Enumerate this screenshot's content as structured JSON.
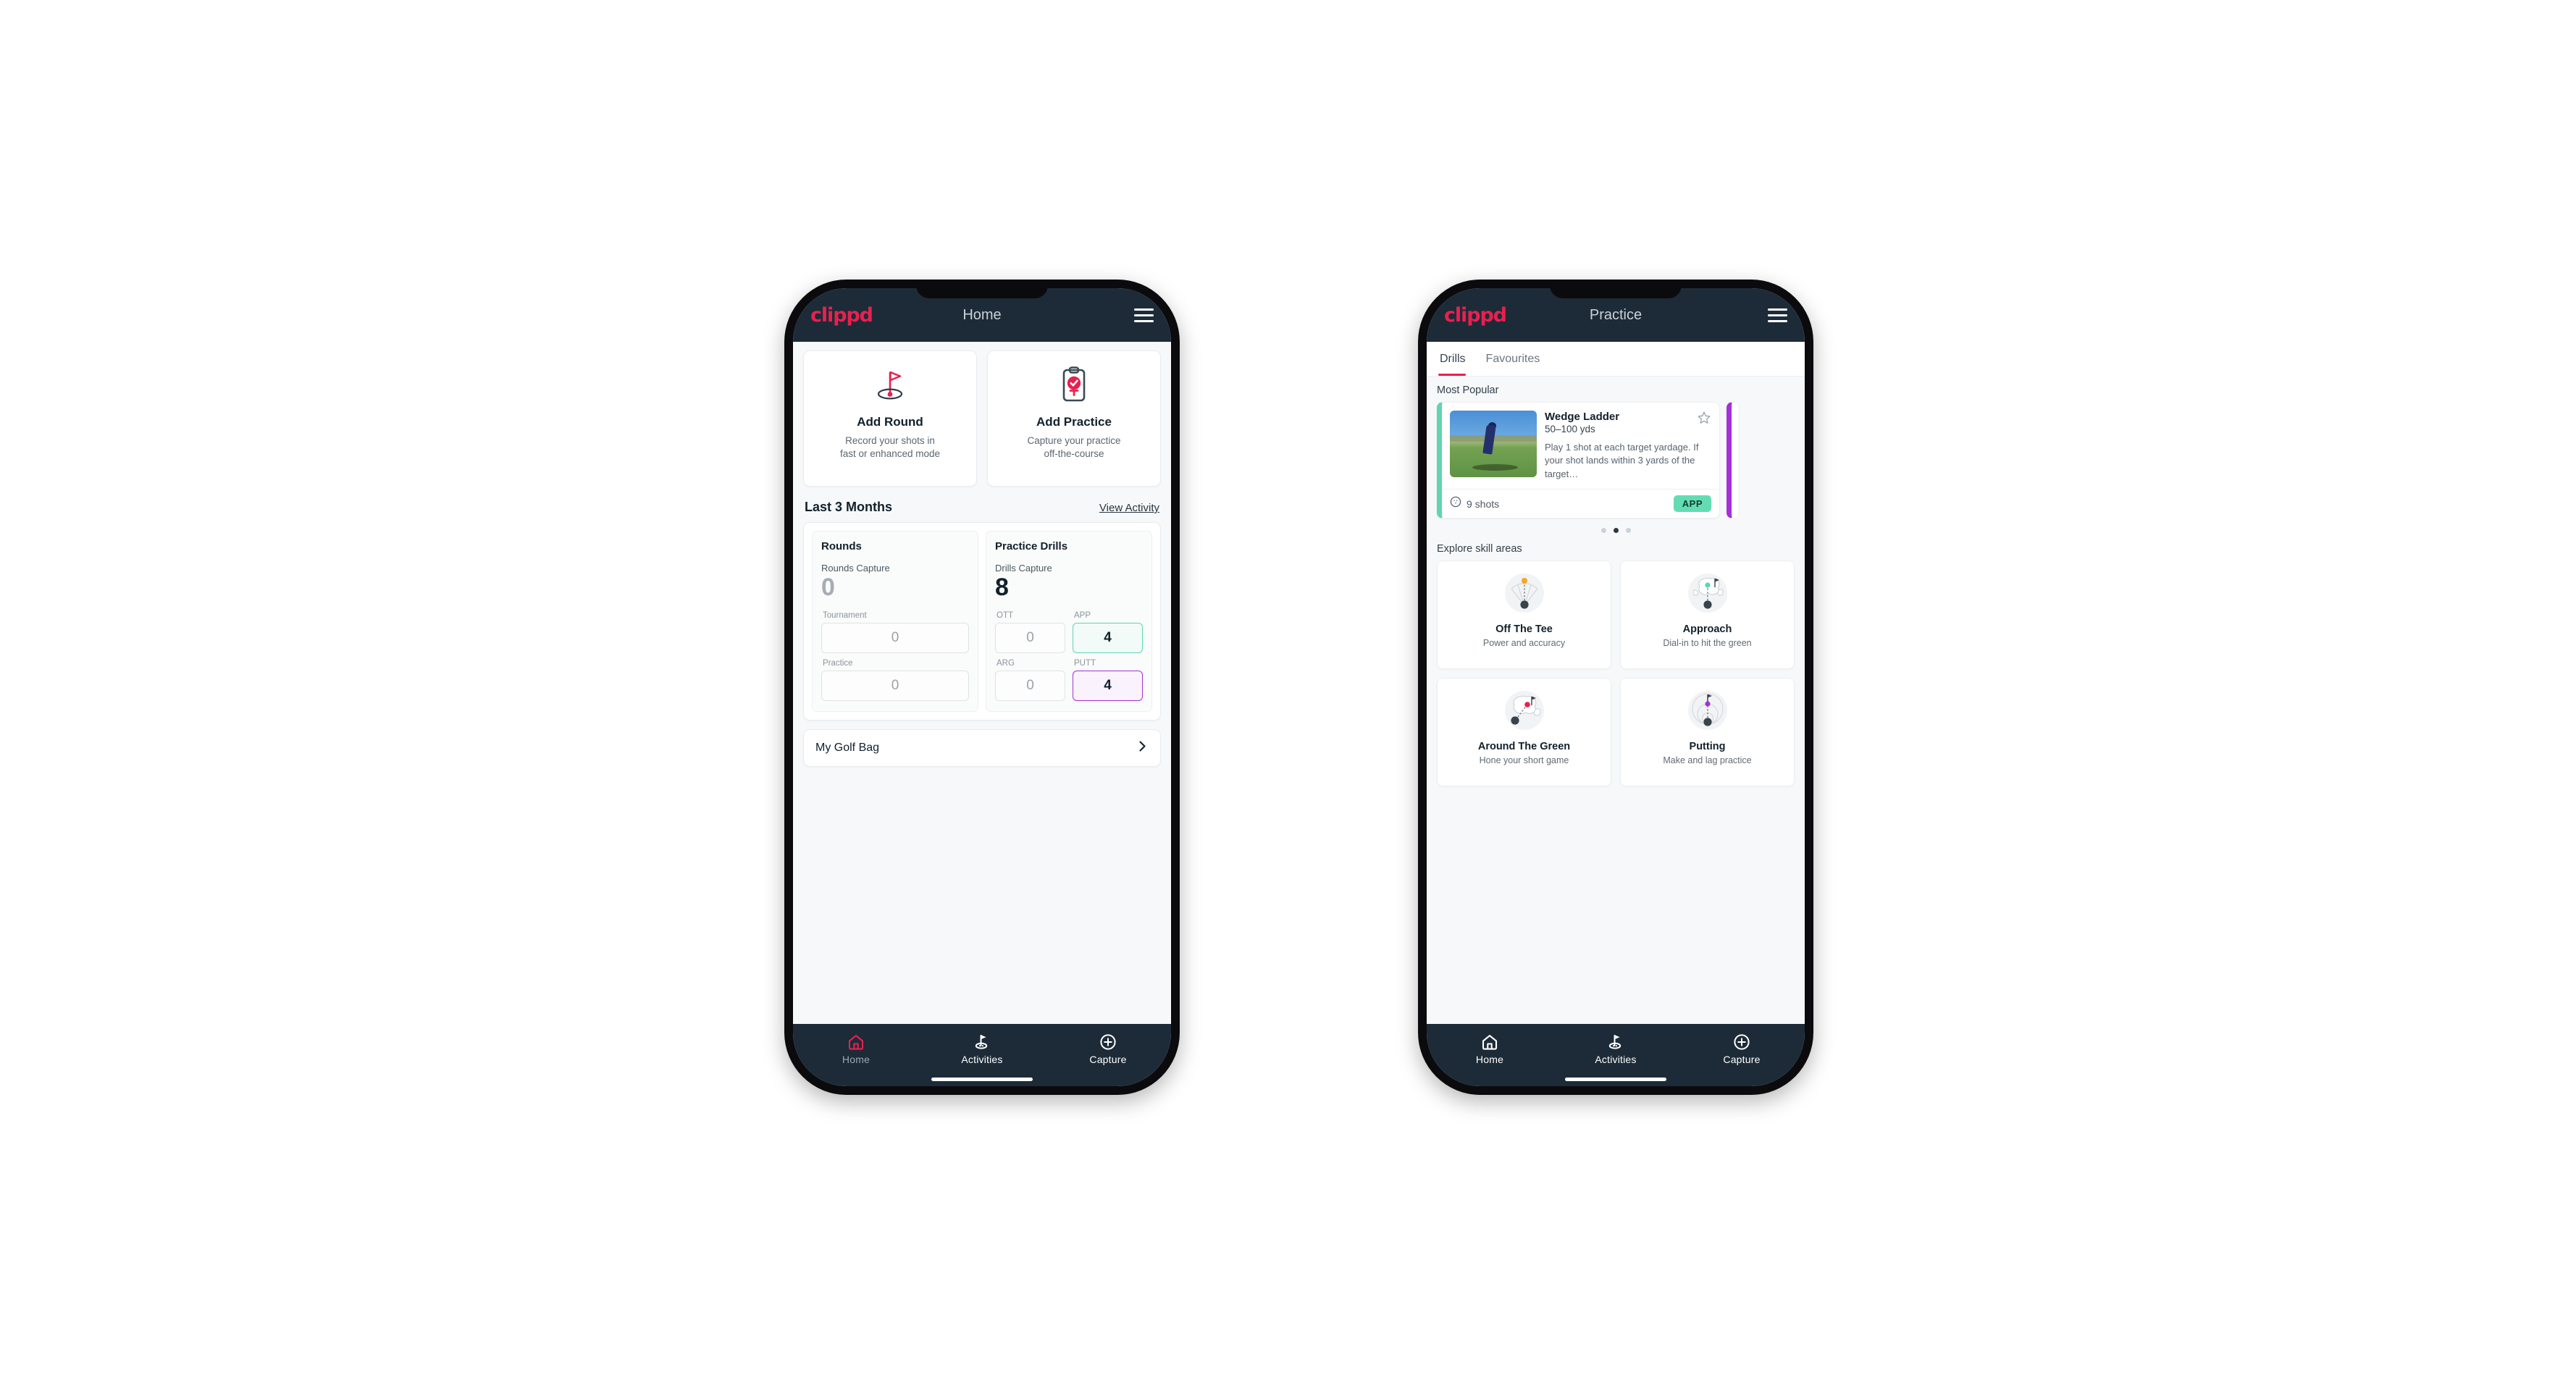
{
  "brand": {
    "name": "clippd",
    "accent": "#e8204e",
    "appbar_bg": "#1d2b38"
  },
  "phone_home": {
    "appbar": {
      "logo": "clippd",
      "title": "Home",
      "menu_icon": "hamburger-icon"
    },
    "actions": [
      {
        "icon": "golf-flag-hole-icon",
        "title": "Add Round",
        "subtitle_line1": "Record your shots in",
        "subtitle_line2": "fast or enhanced mode"
      },
      {
        "icon": "clipboard-check-tee-icon",
        "title": "Add Practice",
        "subtitle_line1": "Capture your practice",
        "subtitle_line2": "off-the-course"
      }
    ],
    "section": {
      "title": "Last 3 Months",
      "link": "View Activity"
    },
    "rounds": {
      "panel_title": "Rounds",
      "capture_label": "Rounds Capture",
      "capture_value": "0",
      "fields": [
        {
          "label": "Tournament",
          "value": "0",
          "state": "empty"
        },
        {
          "label": "Practice",
          "value": "0",
          "state": "empty"
        }
      ]
    },
    "drills": {
      "panel_title": "Practice Drills",
      "capture_label": "Drills Capture",
      "capture_value": "8",
      "fields": [
        {
          "label": "OTT",
          "value": "0",
          "state": "empty"
        },
        {
          "label": "APP",
          "value": "4",
          "state": "green"
        },
        {
          "label": "ARG",
          "value": "0",
          "state": "empty"
        },
        {
          "label": "PUTT",
          "value": "4",
          "state": "purple"
        }
      ]
    },
    "golf_bag": {
      "label": "My Golf Bag",
      "icon": "chevron-right-icon"
    },
    "bottom_nav": [
      {
        "icon": "home-icon",
        "label": "Home",
        "active": true
      },
      {
        "icon": "golf-flag-icon",
        "label": "Activities",
        "active": false
      },
      {
        "icon": "plus-circle-icon",
        "label": "Capture",
        "active": false
      }
    ]
  },
  "phone_practice": {
    "appbar": {
      "logo": "clippd",
      "title": "Practice",
      "menu_icon": "hamburger-icon"
    },
    "tabs": [
      {
        "label": "Drills",
        "active": true
      },
      {
        "label": "Favourites",
        "active": false
      }
    ],
    "most_popular_label": "Most Popular",
    "drill": {
      "title": "Wedge Ladder",
      "yardage": "50–100 yds",
      "description": "Play 1 shot at each target yardage. If your shot lands within 3 yards of the target…",
      "shots": "9 shots",
      "shots_icon": "golf-ball-icon",
      "badge": "APP",
      "badge_color": "#63dcb4",
      "favourite_icon": "star-outline-icon",
      "accent_color": "#5fd6ae",
      "next_card_accent": "#a430d8"
    },
    "carousel_dots": {
      "count": 3,
      "active_index": 1
    },
    "skill_areas_label": "Explore skill areas",
    "skill_areas": [
      {
        "icon": "tee-fan-icon",
        "title": "Off The Tee",
        "subtitle": "Power and accuracy",
        "dot_color": "#f5a623"
      },
      {
        "icon": "green-approach-icon",
        "title": "Approach",
        "subtitle": "Dial-in to hit the green",
        "dot_color": "#5fd6ae"
      },
      {
        "icon": "chip-green-icon",
        "title": "Around The Green",
        "subtitle": "Hone your short game",
        "dot_color": "#e8204e"
      },
      {
        "icon": "putting-rings-icon",
        "title": "Putting",
        "subtitle": "Make and lag practice",
        "dot_color": "#a430d8"
      }
    ],
    "bottom_nav": [
      {
        "icon": "home-icon",
        "label": "Home",
        "active": false
      },
      {
        "icon": "golf-flag-icon",
        "label": "Activities",
        "active": true
      },
      {
        "icon": "plus-circle-icon",
        "label": "Capture",
        "active": false
      }
    ]
  }
}
